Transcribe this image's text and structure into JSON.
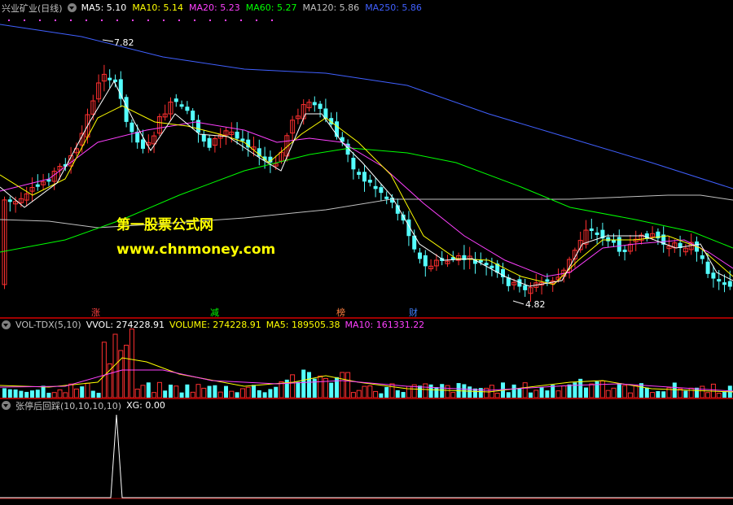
{
  "main": {
    "title": "兴业矿业(日线)",
    "indicators": [
      {
        "label": "MA5: 5.10",
        "color": "#ffffff"
      },
      {
        "label": "MA10: 5.14",
        "color": "#ffff00"
      },
      {
        "label": "MA20: 5.23",
        "color": "#ff40ff"
      },
      {
        "label": "MA60: 5.27",
        "color": "#00ff00"
      },
      {
        "label": "MA120: 5.86",
        "color": "#c0c0c0"
      },
      {
        "label": "MA250: 5.86",
        "color": "#4060ff"
      }
    ],
    "high_label": "7.82",
    "low_label": "4.82"
  },
  "watermark": {
    "line1": "第一股票公式网",
    "line2": "www.chnmoney.com"
  },
  "tags": [
    {
      "text": "涨",
      "color": "#ff4040"
    },
    {
      "text": "减",
      "color": "#00ff00"
    },
    {
      "text": "榜",
      "color": "#ff8040"
    },
    {
      "text": "财",
      "color": "#4080ff"
    }
  ],
  "volume": {
    "title": "VOL-TDX(5,10)",
    "indicators": [
      {
        "label": "VVOL: 274228.91",
        "color": "#ffffff"
      },
      {
        "label": "VOLUME: 274228.91",
        "color": "#ffff00"
      },
      {
        "label": "MA5: 189505.38",
        "color": "#ffff00"
      },
      {
        "label": "MA10: 161331.22",
        "color": "#ff40ff"
      }
    ]
  },
  "signal": {
    "title": "张停后回踩(10,10,10,10)",
    "indicators": [
      {
        "label": "XG: 0.00",
        "color": "#ffffff"
      }
    ]
  },
  "colors": {
    "up": "#ff3030",
    "down": "#54ffff",
    "ma5": "#ffffff",
    "ma10": "#ffff00",
    "ma20": "#ff40ff",
    "ma60": "#00ff00",
    "ma120": "#c0c0c0",
    "ma250": "#4060ff",
    "separator": "#a00000"
  }
}
